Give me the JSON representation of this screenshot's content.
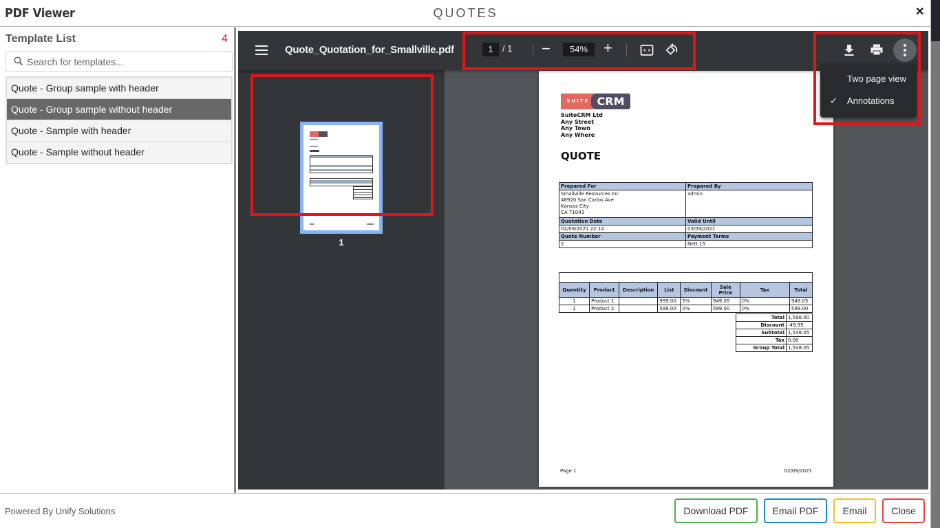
{
  "modal": {
    "title": "PDF Viewer",
    "center_title": "QUOTES",
    "close_icon": "close-x-icon"
  },
  "sidebar": {
    "title": "Template List",
    "count": "4",
    "search": {
      "placeholder": "Search for templates...",
      "value": ""
    },
    "items": [
      {
        "label": "Quote - Group sample with header",
        "active": false
      },
      {
        "label": "Quote - Group sample without header",
        "active": true
      },
      {
        "label": "Quote - Sample with header",
        "active": false
      },
      {
        "label": "Quote - Sample without header",
        "active": false
      }
    ]
  },
  "viewer": {
    "filename": "Quote_Quotation_for_Smallville.pdf",
    "current_page": "1",
    "page_separator": "/ 1",
    "zoom": "54%",
    "zoom_out": "−",
    "zoom_in": "+",
    "thumbnail_label": "1",
    "menu": {
      "items": [
        {
          "label": "Two page view",
          "checked": false
        },
        {
          "label": "Annotations",
          "checked": true
        }
      ],
      "check_glyph": "✓"
    },
    "highlight_color": "#e0161b"
  },
  "document": {
    "logo": {
      "suite": "SUITE",
      "crm": "CRM"
    },
    "address": [
      "SuiteCRM Ltd",
      "Any Street",
      "Any Town",
      "Any Where"
    ],
    "title": "QUOTE",
    "info": {
      "prepared_for_label": "Prepared For",
      "prepared_by_label": "Prepared By",
      "prepared_for": [
        "Smallville Resources Inc",
        "48920 San Carlos Ave",
        "Kansas City",
        "CA 71043"
      ],
      "prepared_by": "admin",
      "quotation_date_label": "Quotation Date",
      "valid_until_label": "Valid Until",
      "quotation_date": "02/09/2021 22:14",
      "valid_until": "03/09/2021",
      "quote_number_label": "Quote Number",
      "payment_terms_label": "Payment Terms",
      "quote_number": "2",
      "payment_terms": "Nett 15"
    },
    "items": {
      "headers": [
        "Quantity",
        "Product",
        "Description",
        "List",
        "Discount",
        "Sale Price",
        "Tax",
        "Total"
      ],
      "rows": [
        [
          "1",
          "Product 1",
          "",
          "999.00",
          "5%",
          "949.05",
          "0%",
          "949.05"
        ],
        [
          "1",
          "Product 2",
          "",
          "599.00",
          "0%",
          "599.00",
          "0%",
          "599.00"
        ]
      ]
    },
    "totals": [
      {
        "label": "Total",
        "value": "1,598.00"
      },
      {
        "label": "Discount",
        "value": "-49.95"
      },
      {
        "label": "Subtotal",
        "value": "1,548.05"
      },
      {
        "label": "Tax",
        "value": "0.00"
      },
      {
        "label": "Group Total",
        "value": "1,548.05"
      }
    ],
    "footer_left": "Page 1",
    "footer_right": "02/09/2021"
  },
  "footer": {
    "powered_by": "Powered By Unify Solutions",
    "buttons": [
      {
        "label": "Download PDF",
        "color": "#4cae4c"
      },
      {
        "label": "Email PDF",
        "color": "#1a8bc4"
      },
      {
        "label": "Email",
        "color": "#f5c11b"
      },
      {
        "label": "Close",
        "color": "#e8453c"
      }
    ]
  }
}
